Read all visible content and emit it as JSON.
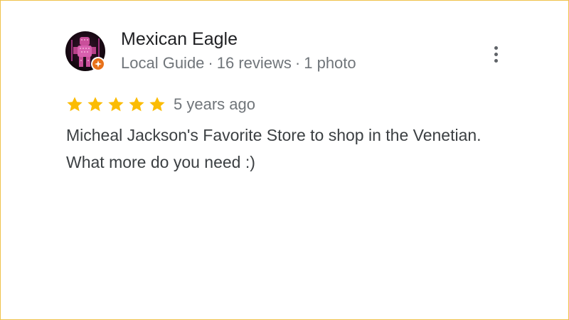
{
  "review": {
    "author_name": "Mexican Eagle",
    "author_level": "Local Guide",
    "reviews_count": "16 reviews",
    "photos_count": "1 photo",
    "separator": "·",
    "rating": 5,
    "rating_max": 5,
    "time_ago": "5 years ago",
    "text": "Micheal Jackson's Favorite Store to shop in the Venetian. What more do you need :)"
  },
  "icons": {
    "avatar": "avatar-image",
    "badge": "local-guide-badge-icon",
    "menu": "more-vert-icon",
    "star": "star-icon"
  },
  "colors": {
    "star": "#fbbc04",
    "badge": "#e8711a",
    "border": "#f0c24b",
    "name": "#202124",
    "meta": "#70757a"
  }
}
